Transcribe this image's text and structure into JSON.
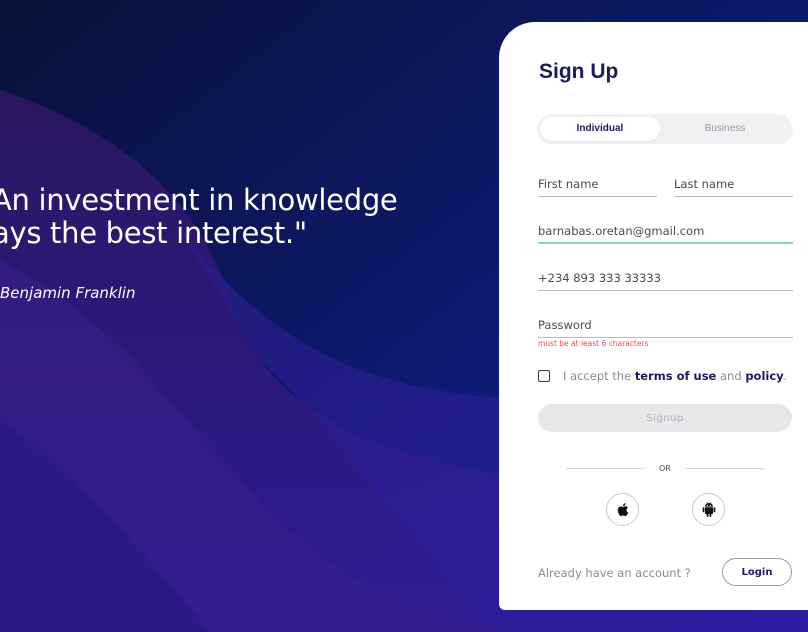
{
  "hero": {
    "quote_line1": "An investment in knowledge",
    "quote_line2": "ays the best interest.\"",
    "author": "Benjamin Franklin"
  },
  "form": {
    "title": "Sign Up",
    "tabs": [
      {
        "label": "Individual",
        "selected": true
      },
      {
        "label": "Business",
        "selected": false
      }
    ],
    "first_name": {
      "placeholder": "First name"
    },
    "last_name": {
      "placeholder": "Last name"
    },
    "email": {
      "value": "barnabas.oretan@gmail.com"
    },
    "phone": {
      "value": "+234 893 333 33333"
    },
    "password": {
      "placeholder": "Password",
      "error": "must be at least 6 characters"
    },
    "terms": {
      "checked": false,
      "prefix": "I accept the ",
      "terms_link": "terms of use",
      "and": " and ",
      "policy_link": "policy",
      "suffix": "."
    },
    "signup_label": "Signup",
    "divider_text": "OR",
    "social": [
      {
        "icon": "apple-icon"
      },
      {
        "icon": "android-icon"
      }
    ],
    "have_account": "Already have an account ?",
    "login_label": "Login"
  },
  "colors": {
    "bg_dark": "#0b1656",
    "bg_purple": "#2a1f8f",
    "brand_navy": "#1d1a5e",
    "focus_green": "#7fd8b2",
    "error_red": "#e8485a"
  }
}
